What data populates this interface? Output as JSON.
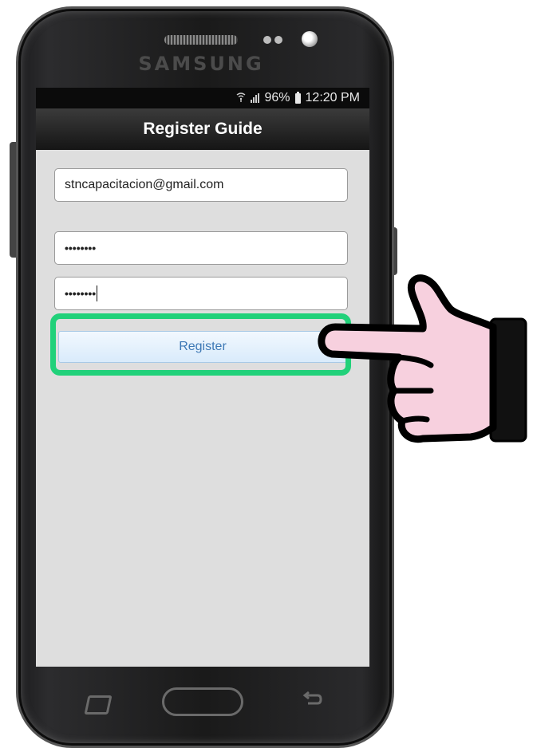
{
  "device": {
    "brand": "SAMSUNG"
  },
  "status_bar": {
    "battery_percent": "96%",
    "time": "12:20 PM"
  },
  "header": {
    "title": "Register Guide"
  },
  "form": {
    "email_value": "stncapacitacion@gmail.com",
    "password_value": "••••••••",
    "confirm_password_value": "••••••••",
    "register_label": "Register"
  },
  "highlight": {
    "color": "#21d17a"
  },
  "icons": [
    "wifi-icon",
    "signal-icon",
    "battery-icon",
    "pointing-hand-icon",
    "recent-apps-key-icon",
    "home-key-icon",
    "back-key-icon"
  ]
}
